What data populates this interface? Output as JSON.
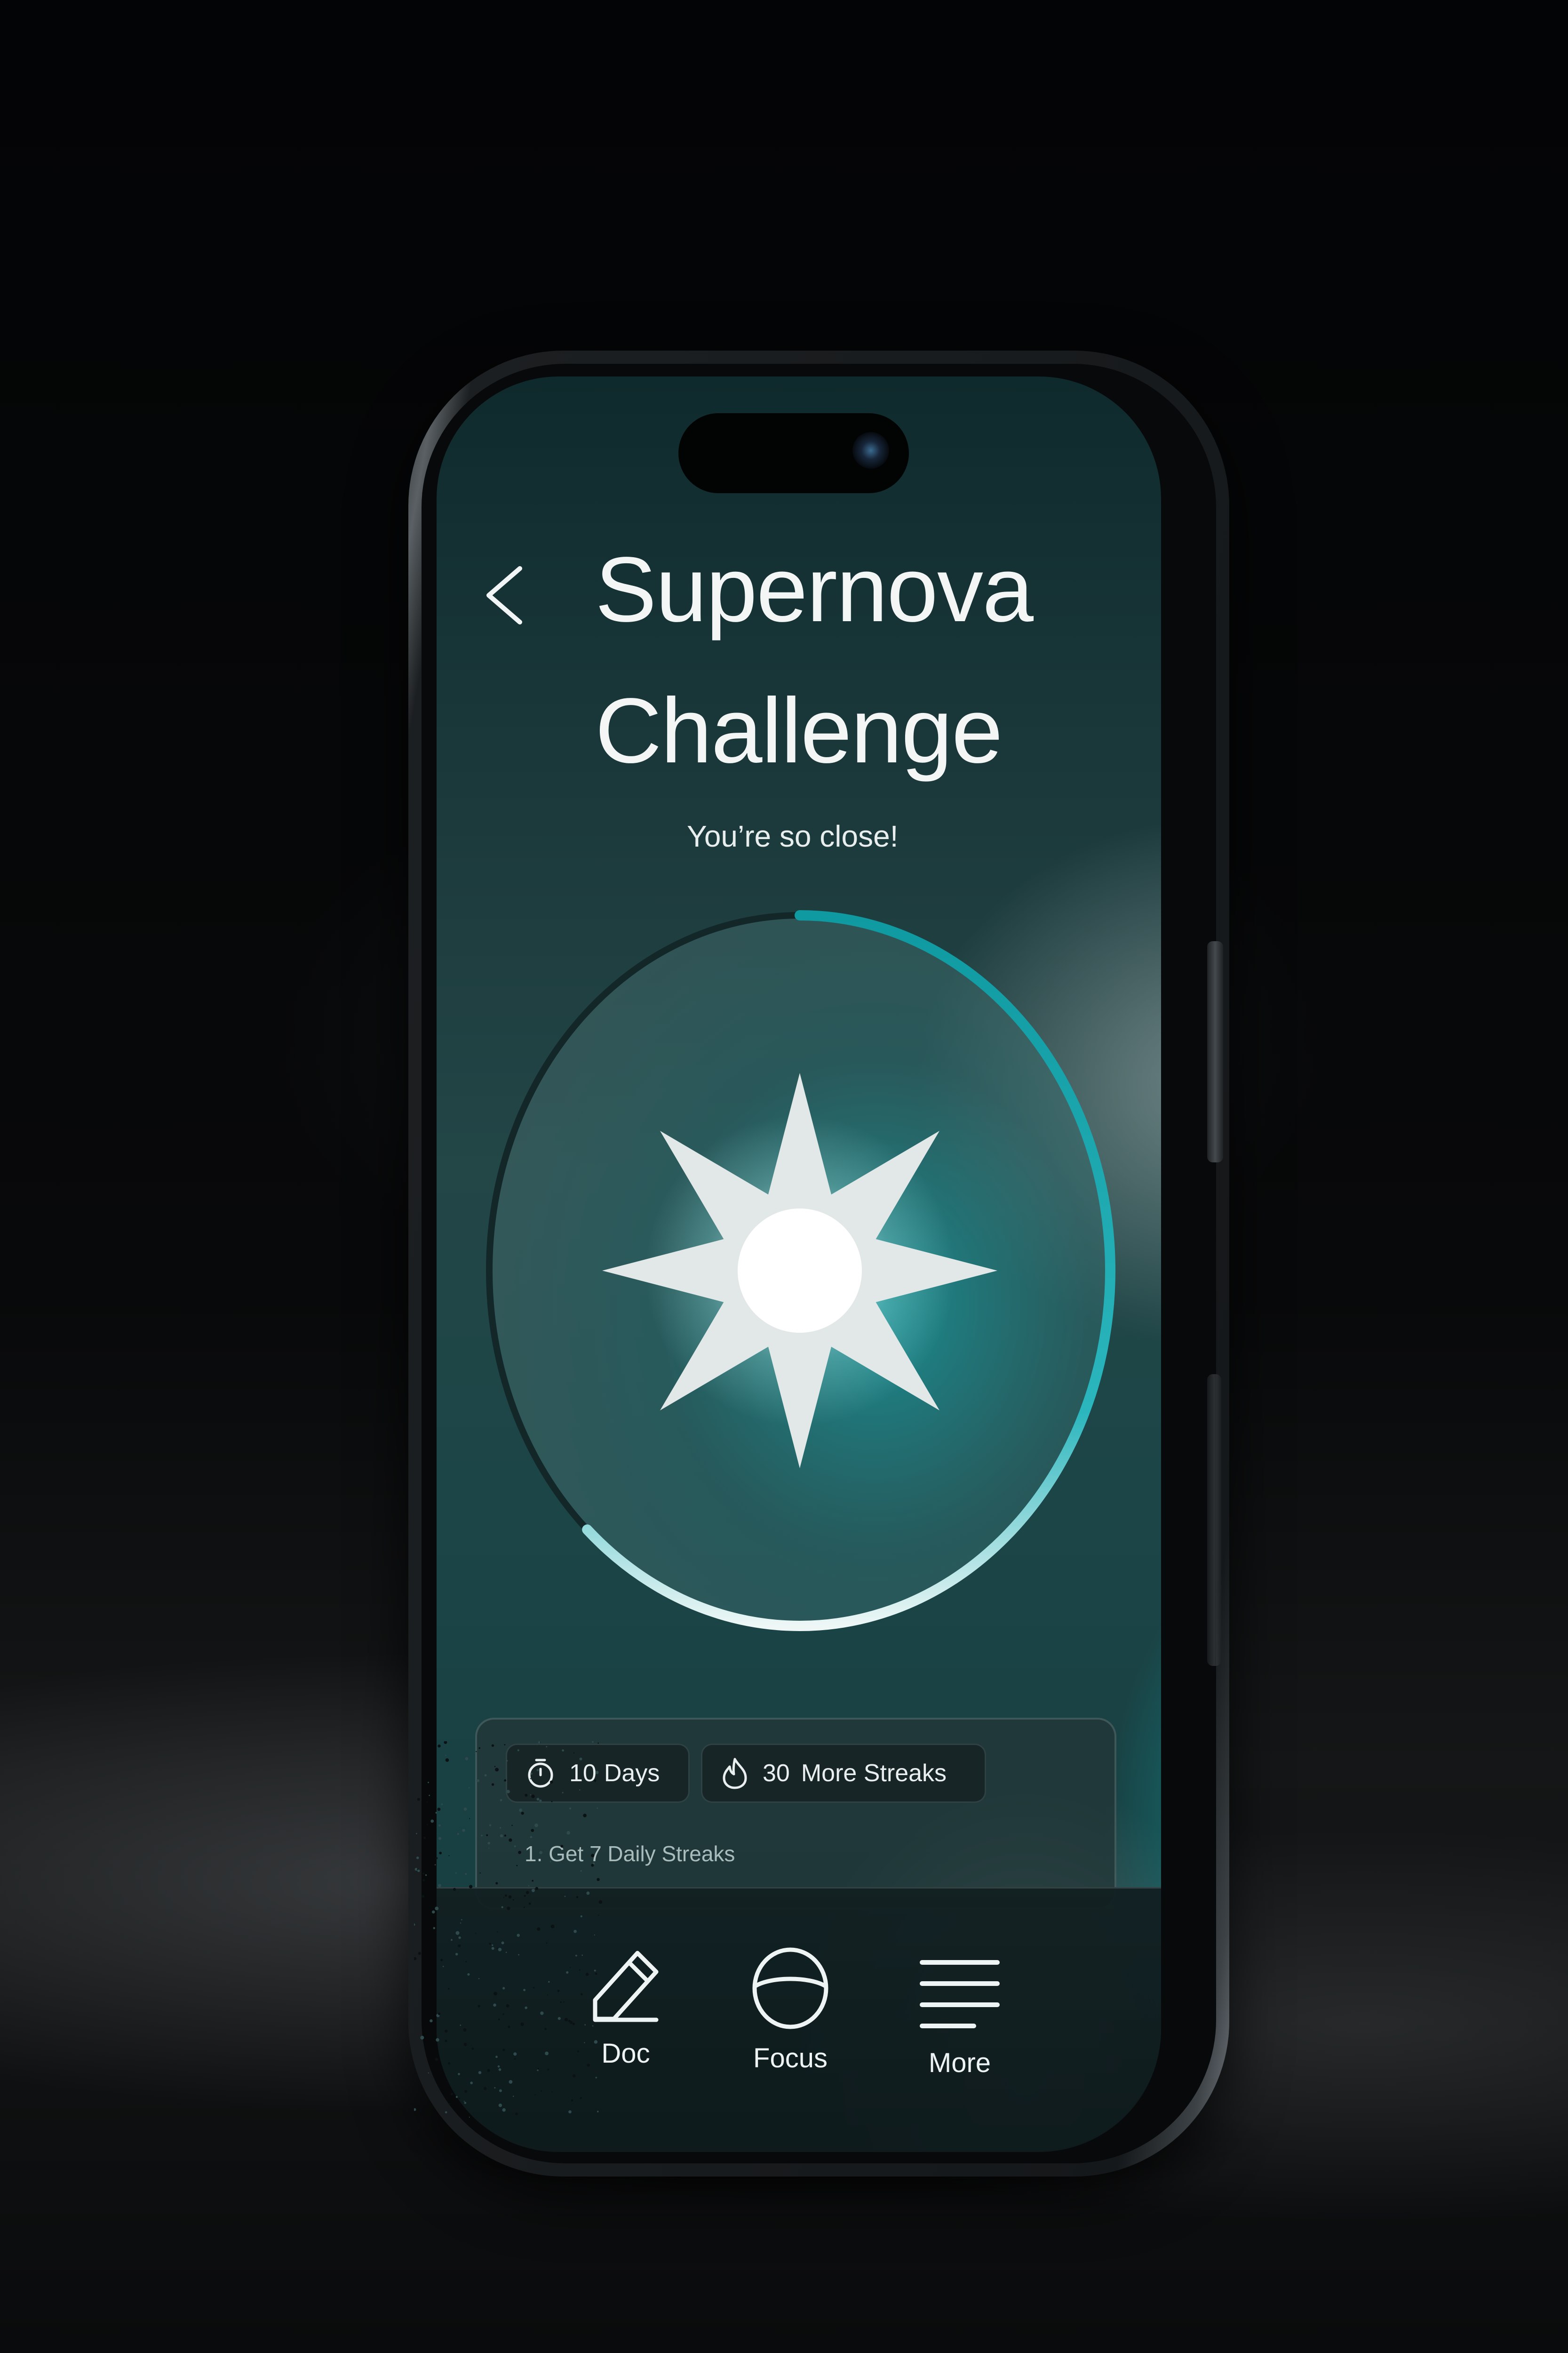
{
  "header": {
    "title_line1": "Supernova",
    "title_line2": "Challenge",
    "subtitle": "You’re so close!"
  },
  "progress": {
    "fraction_complete": 0.62,
    "badge_icon": "star-burst-icon"
  },
  "challenge_card": {
    "days": {
      "value": "10",
      "label": "Days",
      "icon": "stopwatch-icon"
    },
    "streaks": {
      "value": "30",
      "label": "More Streaks",
      "icon": "flame-icon"
    },
    "tasks": [
      "1. Get 7 Daily Streaks"
    ]
  },
  "tab_bar": {
    "items": [
      {
        "label": "Doc",
        "icon": "pencil-icon"
      },
      {
        "label": "Focus",
        "icon": "focus-circle-icon"
      },
      {
        "label": "More",
        "icon": "menu-lines-icon"
      }
    ]
  },
  "colors": {
    "accent_teal": "#11b5bc",
    "ring_light": "#e7f2f1",
    "text_primary": "#f4f6f6"
  }
}
